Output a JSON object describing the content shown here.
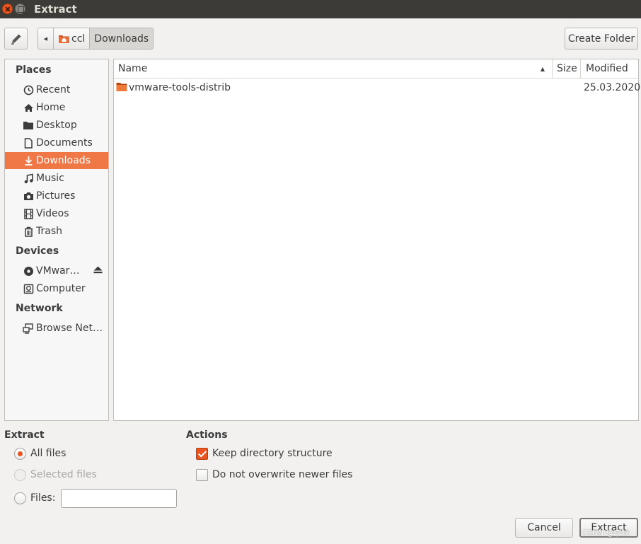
{
  "window": {
    "title": "Extract"
  },
  "toolbar": {
    "breadcrumb": [
      "ccl",
      "Downloads"
    ],
    "create_folder_label": "Create Folder"
  },
  "sidebar": {
    "places_heading": "Places",
    "places": [
      {
        "label": "Recent",
        "icon": "clock-icon"
      },
      {
        "label": "Home",
        "icon": "home-icon"
      },
      {
        "label": "Desktop",
        "icon": "folder-icon"
      },
      {
        "label": "Documents",
        "icon": "document-icon"
      },
      {
        "label": "Downloads",
        "icon": "download-icon",
        "selected": true
      },
      {
        "label": "Music",
        "icon": "music-icon"
      },
      {
        "label": "Pictures",
        "icon": "camera-icon"
      },
      {
        "label": "Videos",
        "icon": "film-icon"
      },
      {
        "label": "Trash",
        "icon": "trash-icon"
      }
    ],
    "devices_heading": "Devices",
    "devices": [
      {
        "label": "VMwar…",
        "icon": "disc-icon"
      },
      {
        "label": "Computer",
        "icon": "harddisk-icon"
      }
    ],
    "network_heading": "Network",
    "network": [
      {
        "label": "Browse Net…",
        "icon": "network-icon"
      }
    ]
  },
  "filelist": {
    "columns": {
      "name": "Name",
      "size": "Size",
      "modified": "Modified"
    },
    "rows": [
      {
        "name": "vmware-tools-distrib",
        "size": "",
        "modified": "25.03.2020"
      }
    ]
  },
  "extract": {
    "title": "Extract",
    "all_files": "All files",
    "selected_files": "Selected files",
    "files": "Files:",
    "files_value": ""
  },
  "actions": {
    "title": "Actions",
    "keep_structure": "Keep directory structure",
    "keep_structure_checked": true,
    "no_overwrite": "Do not overwrite newer files",
    "no_overwrite_checked": false
  },
  "buttons": {
    "cancel": "Cancel",
    "extract": "Extract"
  },
  "watermark": "CSDN @李坟",
  "colors": {
    "accent": "#e95420",
    "selection": "#f07746",
    "titlebar": "#3c3b37"
  }
}
